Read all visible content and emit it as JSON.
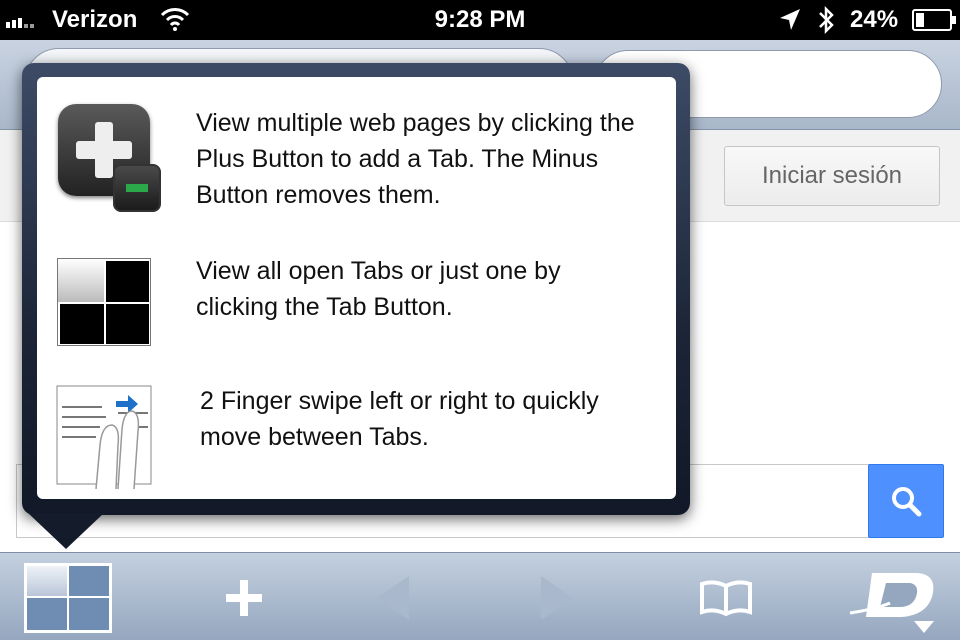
{
  "status_bar": {
    "carrier": "Verizon",
    "time": "9:28 PM",
    "battery_percent": "24%",
    "battery_level": 0.24,
    "icons": [
      "signal-icon",
      "wifi-icon",
      "location-icon",
      "bluetooth-icon",
      "battery-icon"
    ]
  },
  "page": {
    "login_button": "Iniciar sesión"
  },
  "help_popover": {
    "items": [
      {
        "icon": "plus-minus-tab-icon",
        "text": "View multiple web pages by clicking the Plus Button to add a Tab.  The Minus Button removes them."
      },
      {
        "icon": "tabs-grid-icon",
        "text": "View all open Tabs or just one by clicking the Tab Button."
      },
      {
        "icon": "two-finger-swipe-icon",
        "text": "2 Finger swipe left or right to quickly move between Tabs."
      }
    ]
  },
  "toolbar": {
    "buttons": [
      "tabs-button",
      "add-tab-button",
      "back-button",
      "forward-button",
      "bookmarks-button",
      "app-menu-button"
    ]
  },
  "colors": {
    "search_button": "#4d90fe",
    "minus_accent": "#2aa84a",
    "toolbar_top": "#c4d0df",
    "toolbar_bottom": "#95a7bf"
  }
}
